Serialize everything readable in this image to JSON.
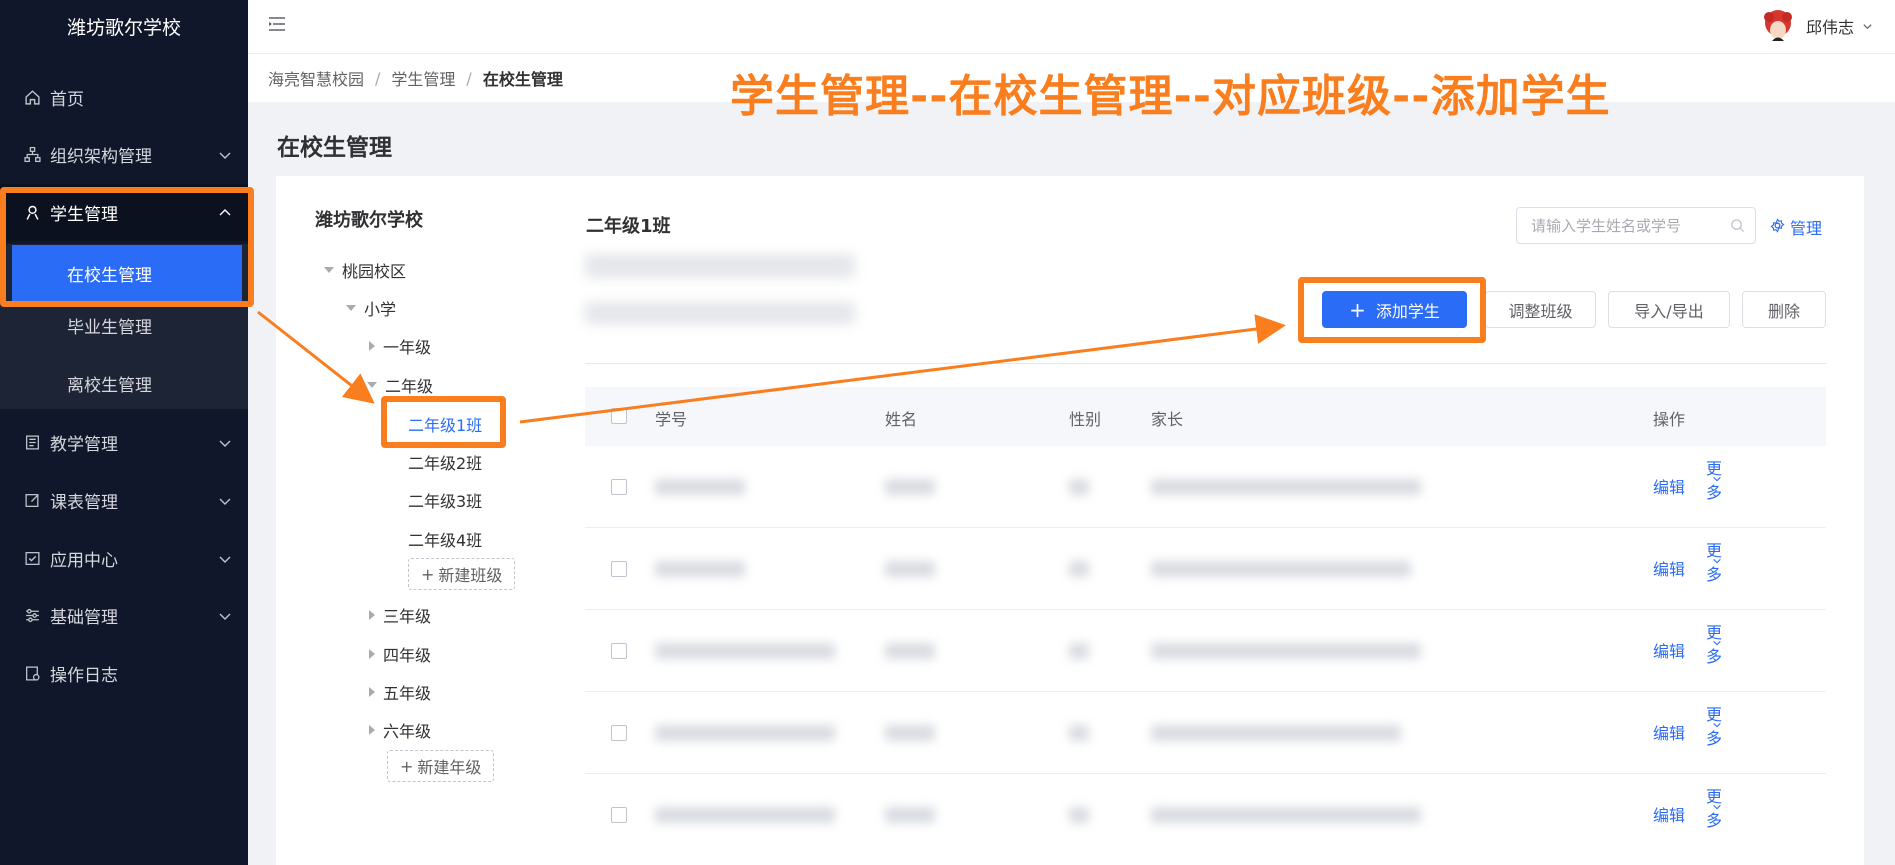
{
  "sidebar": {
    "logo": "潍坊歌尔学校",
    "menu": [
      {
        "label": "首页",
        "icon": "home-icon"
      },
      {
        "label": "组织架构管理",
        "icon": "org-icon"
      },
      {
        "label": "学生管理",
        "icon": "student-icon"
      },
      {
        "label": "教学管理",
        "icon": "teaching-icon"
      },
      {
        "label": "课表管理",
        "icon": "schedule-icon"
      },
      {
        "label": "应用中心",
        "icon": "apps-icon"
      },
      {
        "label": "基础管理",
        "icon": "settings-icon"
      },
      {
        "label": "操作日志",
        "icon": "log-icon"
      }
    ],
    "student_sub": [
      "在校生管理",
      "毕业生管理",
      "离校生管理"
    ]
  },
  "header": {
    "user_name": "邱伟志"
  },
  "breadcrumb": [
    "海亮智慧校园",
    "学生管理",
    "在校生管理"
  ],
  "annotation_title": "学生管理--在校生管理--对应班级--添加学生",
  "page_title": "在校生管理",
  "tree": {
    "root": "潍坊歌尔学校",
    "campus": "桃园校区",
    "level": "小学",
    "grades": [
      "一年级",
      "二年级",
      "三年级",
      "四年级",
      "五年级",
      "六年级"
    ],
    "classes": [
      "二年级1班",
      "二年级2班",
      "二年级3班",
      "二年级4班"
    ],
    "new_class": "新建班级",
    "new_grade": "新建年级"
  },
  "panel": {
    "class_title": "二年级1班",
    "search_placeholder": "请输入学生姓名或学号",
    "manage_label": "管理",
    "buttons": {
      "add": "添加学生",
      "adjust": "调整班级",
      "import_export": "导入/导出",
      "delete": "删除"
    }
  },
  "table": {
    "columns": [
      "学号",
      "姓名",
      "性别",
      "家长",
      "操作"
    ],
    "row_actions": {
      "edit": "编辑",
      "more": "更多"
    },
    "row_count": 5
  },
  "colors": {
    "accent": "#2b6cf6",
    "annotation": "#fa7d1e",
    "sidebar_bg": "#10172a"
  }
}
